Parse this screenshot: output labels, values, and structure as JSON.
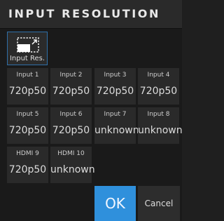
{
  "title": "INPUT RESOLUTION",
  "input_res_button": {
    "label": "Input Res.",
    "icon": "resolution-icon"
  },
  "inputs": [
    {
      "name": "Input 1",
      "value": "720p50"
    },
    {
      "name": "Input 2",
      "value": "720p50"
    },
    {
      "name": "Input 3",
      "value": "720p50"
    },
    {
      "name": "Input 4",
      "value": "720p50"
    },
    {
      "name": "Input 5",
      "value": "720p50"
    },
    {
      "name": "Input 6",
      "value": "720p50"
    },
    {
      "name": "Input 7",
      "value": "unknown"
    },
    {
      "name": "Input 8",
      "value": "unknown"
    },
    {
      "name": "HDMI 9",
      "value": "720p50"
    },
    {
      "name": "HDMI 10",
      "value": "unknown"
    }
  ],
  "buttons": {
    "ok": "OK",
    "cancel": "Cancel"
  },
  "colors": {
    "background": "#1a1a1a",
    "panel": "#2a2a2a",
    "ok_accent": "#2f90dc",
    "selection_border": "#2f6fa7"
  }
}
